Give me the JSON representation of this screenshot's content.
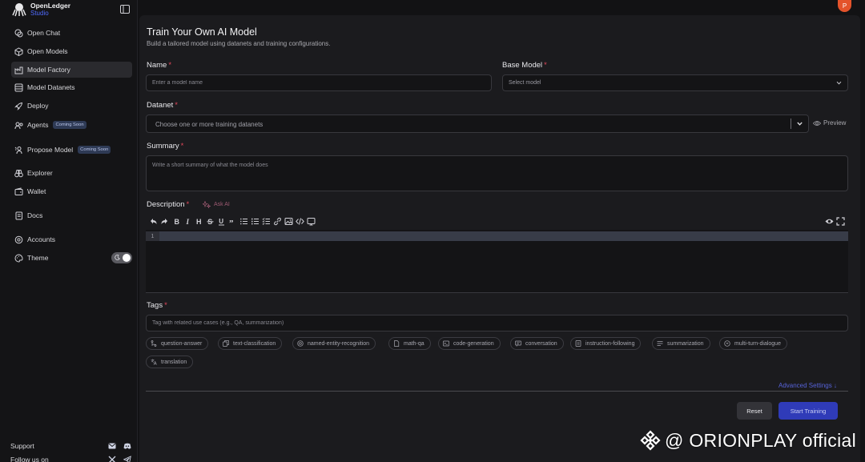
{
  "brand": {
    "name": "OpenLedger",
    "sub": "Studio"
  },
  "sidebar": {
    "items": [
      {
        "label": "Open Chat",
        "icon": "chat-icon"
      },
      {
        "label": "Open Models",
        "icon": "cube-icon"
      },
      {
        "label": "Model Factory",
        "icon": "factory-icon",
        "active": true
      },
      {
        "label": "Model Datanets",
        "icon": "database-icon"
      },
      {
        "label": "Deploy",
        "icon": "rocket-icon"
      },
      {
        "label": "Agents",
        "icon": "agent-icon",
        "badge": "Coming Soon"
      },
      {
        "label": "Propose Model",
        "icon": "propose-icon",
        "badge": "Coming Soon"
      },
      {
        "label": "Explorer",
        "icon": "binoculars-icon"
      },
      {
        "label": "Wallet",
        "icon": "wallet-icon"
      },
      {
        "label": "Docs",
        "icon": "docs-icon"
      },
      {
        "label": "Accounts",
        "icon": "accounts-icon"
      },
      {
        "label": "Theme",
        "icon": "palette-icon"
      }
    ],
    "support_label": "Support",
    "follow_label": "Follow us on"
  },
  "user": {
    "avatar_initial": "P",
    "avatar_color": "#e4532b"
  },
  "page": {
    "title": "Train Your Own AI Model",
    "subtitle": "Build a tailored model using datanets and training configurations."
  },
  "form": {
    "name_label": "Name",
    "name_placeholder": "Enter a model name",
    "base_model_label": "Base Model",
    "base_model_value": "Select model",
    "datanet_label": "Datanet",
    "datanet_value": "Choose one or more training datanets",
    "preview_label": "Preview",
    "summary_label": "Summary",
    "summary_placeholder": "Write a short summary of what the model does",
    "description_label": "Description",
    "ask_ai_label": "Ask AI",
    "editor_line_number": "1",
    "tags_label": "Tags",
    "tags_placeholder": "Tag with related use cases (e.g., QA, summarization)",
    "required_mark": "*"
  },
  "tags": [
    "question-answer",
    "text-classification",
    "named-entity-recognition",
    "math-qa",
    "code-generation",
    "conversation",
    "instruction-following",
    "summarization",
    "multi-turn-dialogue",
    "translation"
  ],
  "advanced_settings_label": "Advanced Settings ↓",
  "actions": {
    "reset_label": "Reset",
    "start_label": "Start Training"
  },
  "watermark": "@ ORIONPLAY official",
  "colors": {
    "accent": "#2f3bb8",
    "link": "#5662d8",
    "required": "#e0475a",
    "badge_bg": "#2e3a55"
  }
}
